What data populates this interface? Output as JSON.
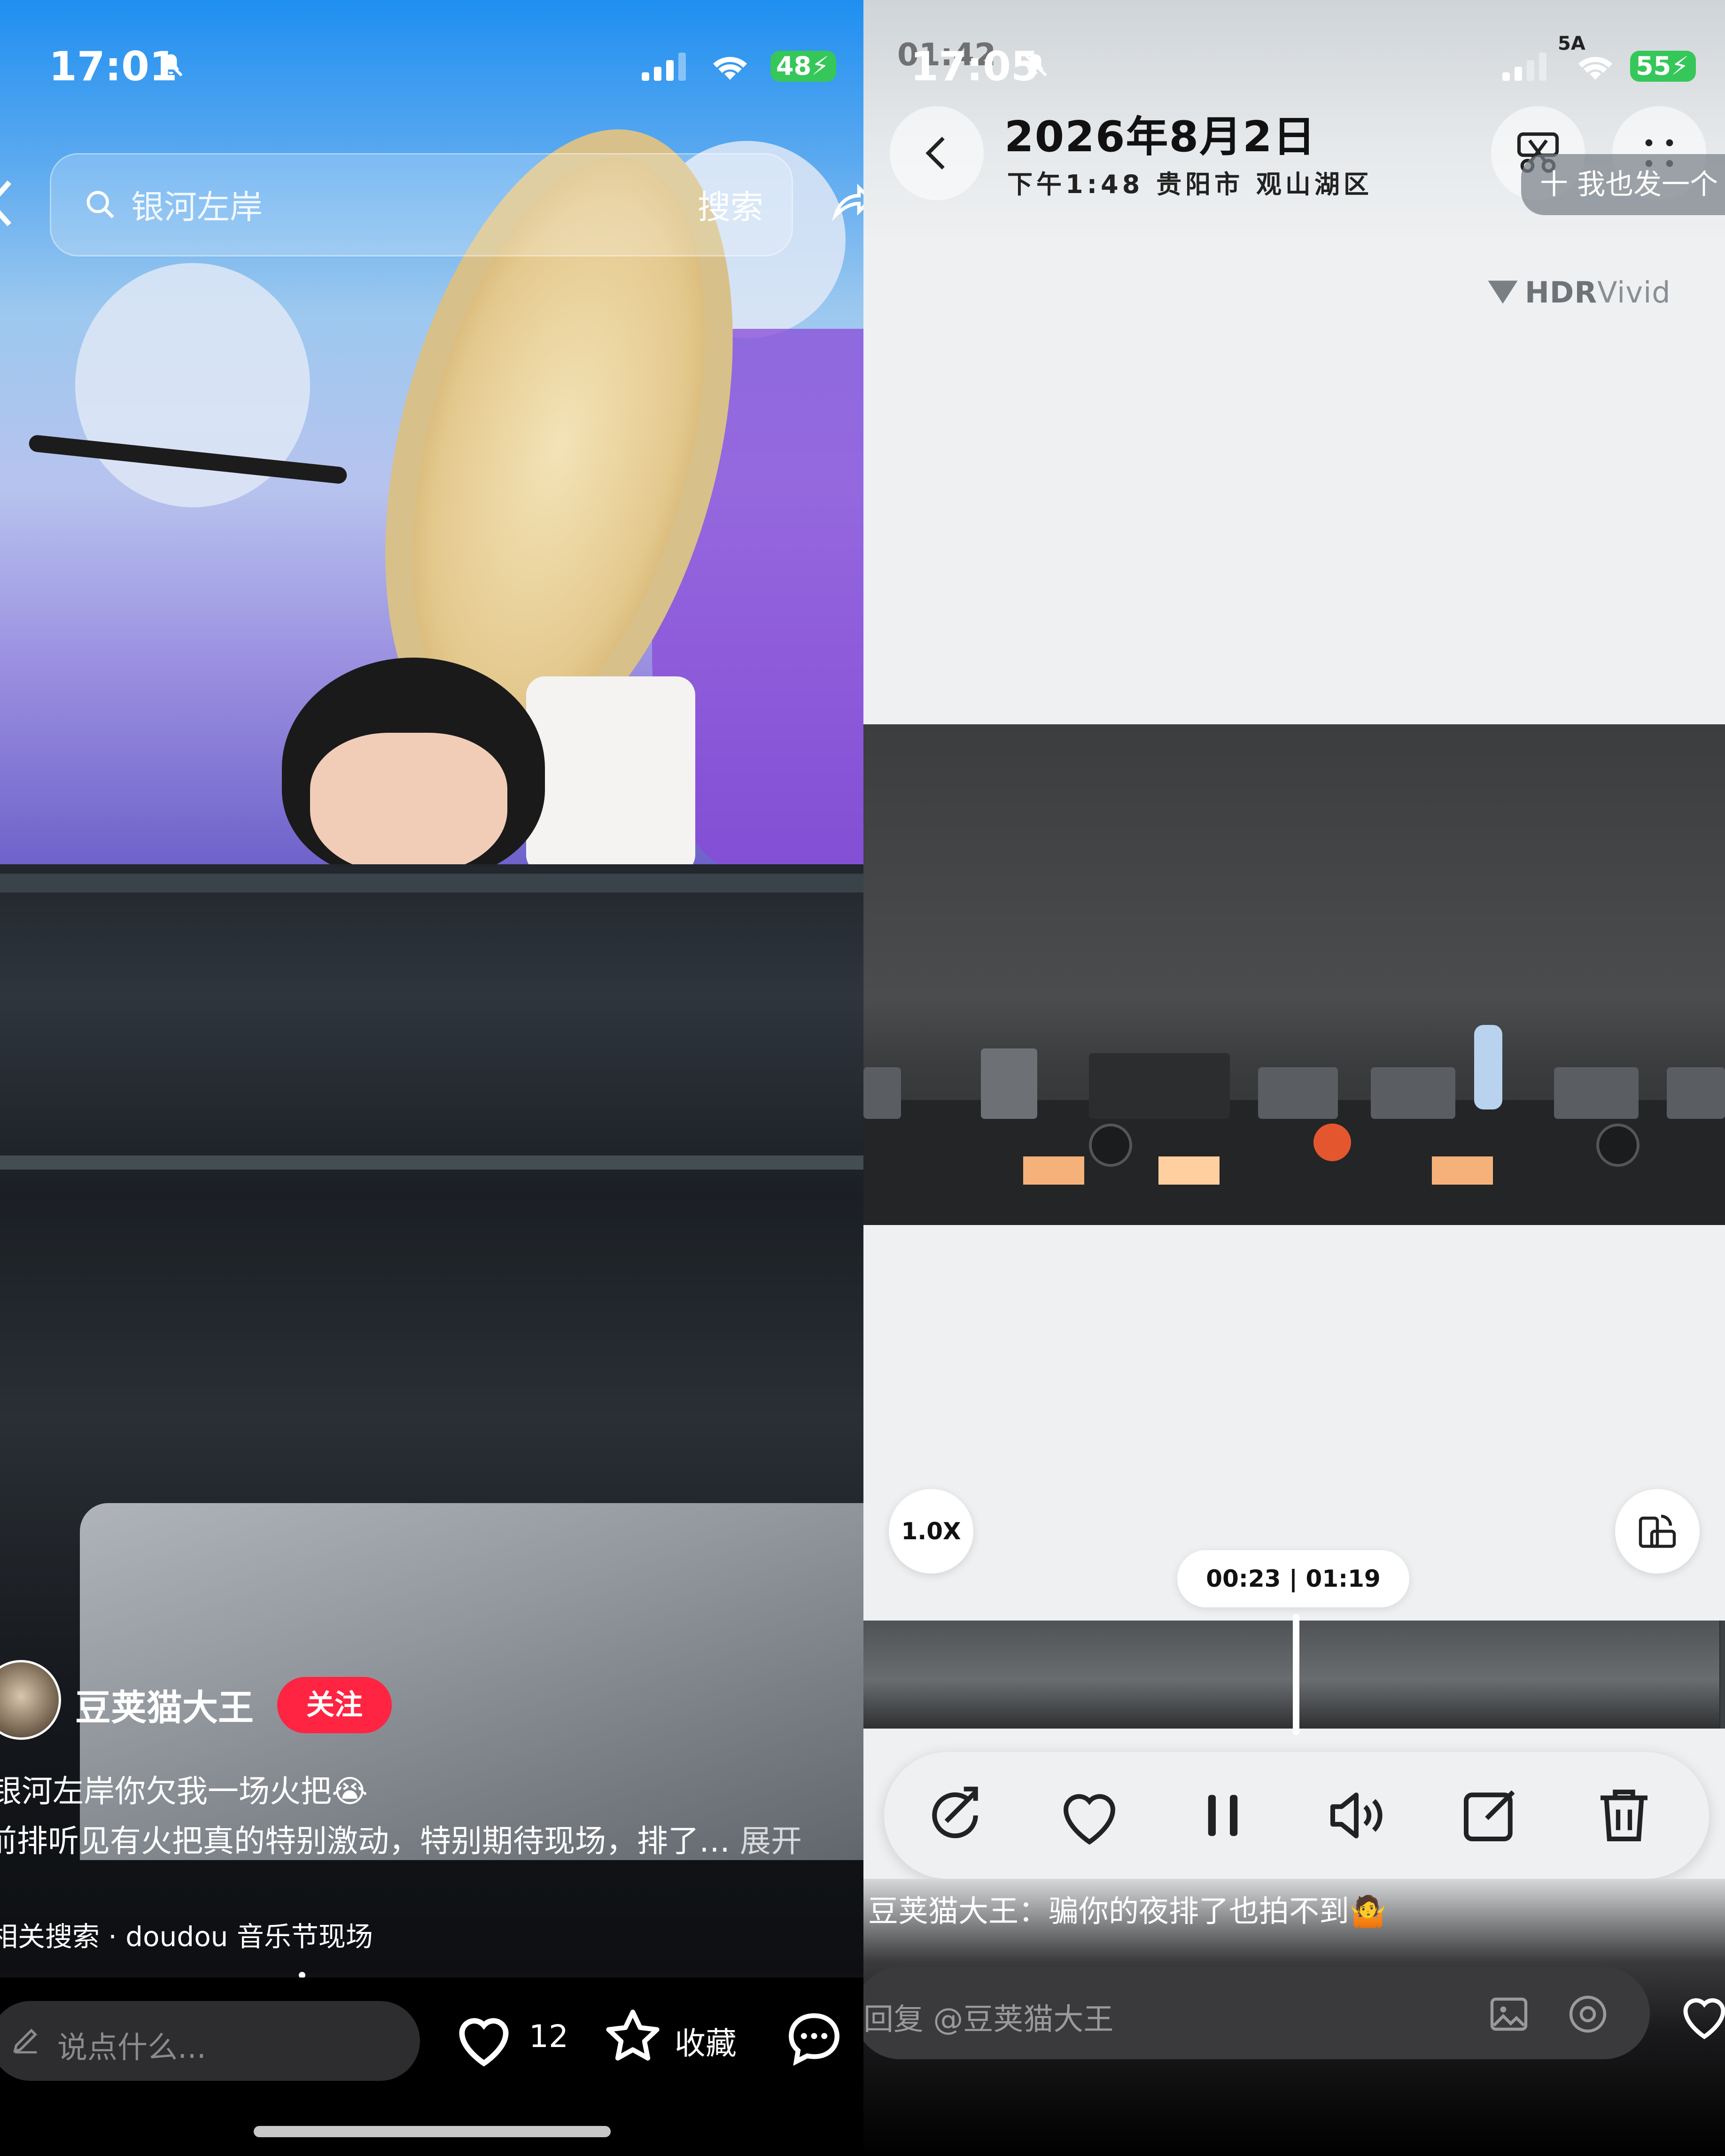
{
  "left": {
    "status": {
      "time": "17:01",
      "battery": "48"
    },
    "search": {
      "placeholder": "银河左岸",
      "button": "搜索"
    },
    "author": {
      "name": "豆荚猫大王",
      "follow_label": "关注"
    },
    "post": {
      "title": "银河左岸你欠我一场火把😭",
      "body": "前排听见有火把真的特别激动，特别期待现场，排了…",
      "expand": "展开",
      "related": "相关搜索 · doudou 音乐节现场"
    },
    "bottom": {
      "comment_placeholder": "说点什么...",
      "likes": "12",
      "favorite_label": "收藏"
    }
  },
  "right": {
    "status": {
      "time": "17:05",
      "ghost_time": "01:42",
      "battery": "55",
      "network": "5A"
    },
    "header": {
      "date": "2026年8月2日",
      "subtitle": "下午1:48 贵阳市 观山湖区",
      "post_too": "十 我也发一个"
    },
    "badge": {
      "hdr_a": "HDR",
      "hdr_b": "Vivid"
    },
    "player": {
      "speed": "1.0X",
      "time": "00:23 | 01:19"
    },
    "comment": {
      "text": "豆荚猫大王：骗你的夜排了也拍不到🤷",
      "reply_placeholder": "回复 @豆荚猫大王"
    }
  }
}
